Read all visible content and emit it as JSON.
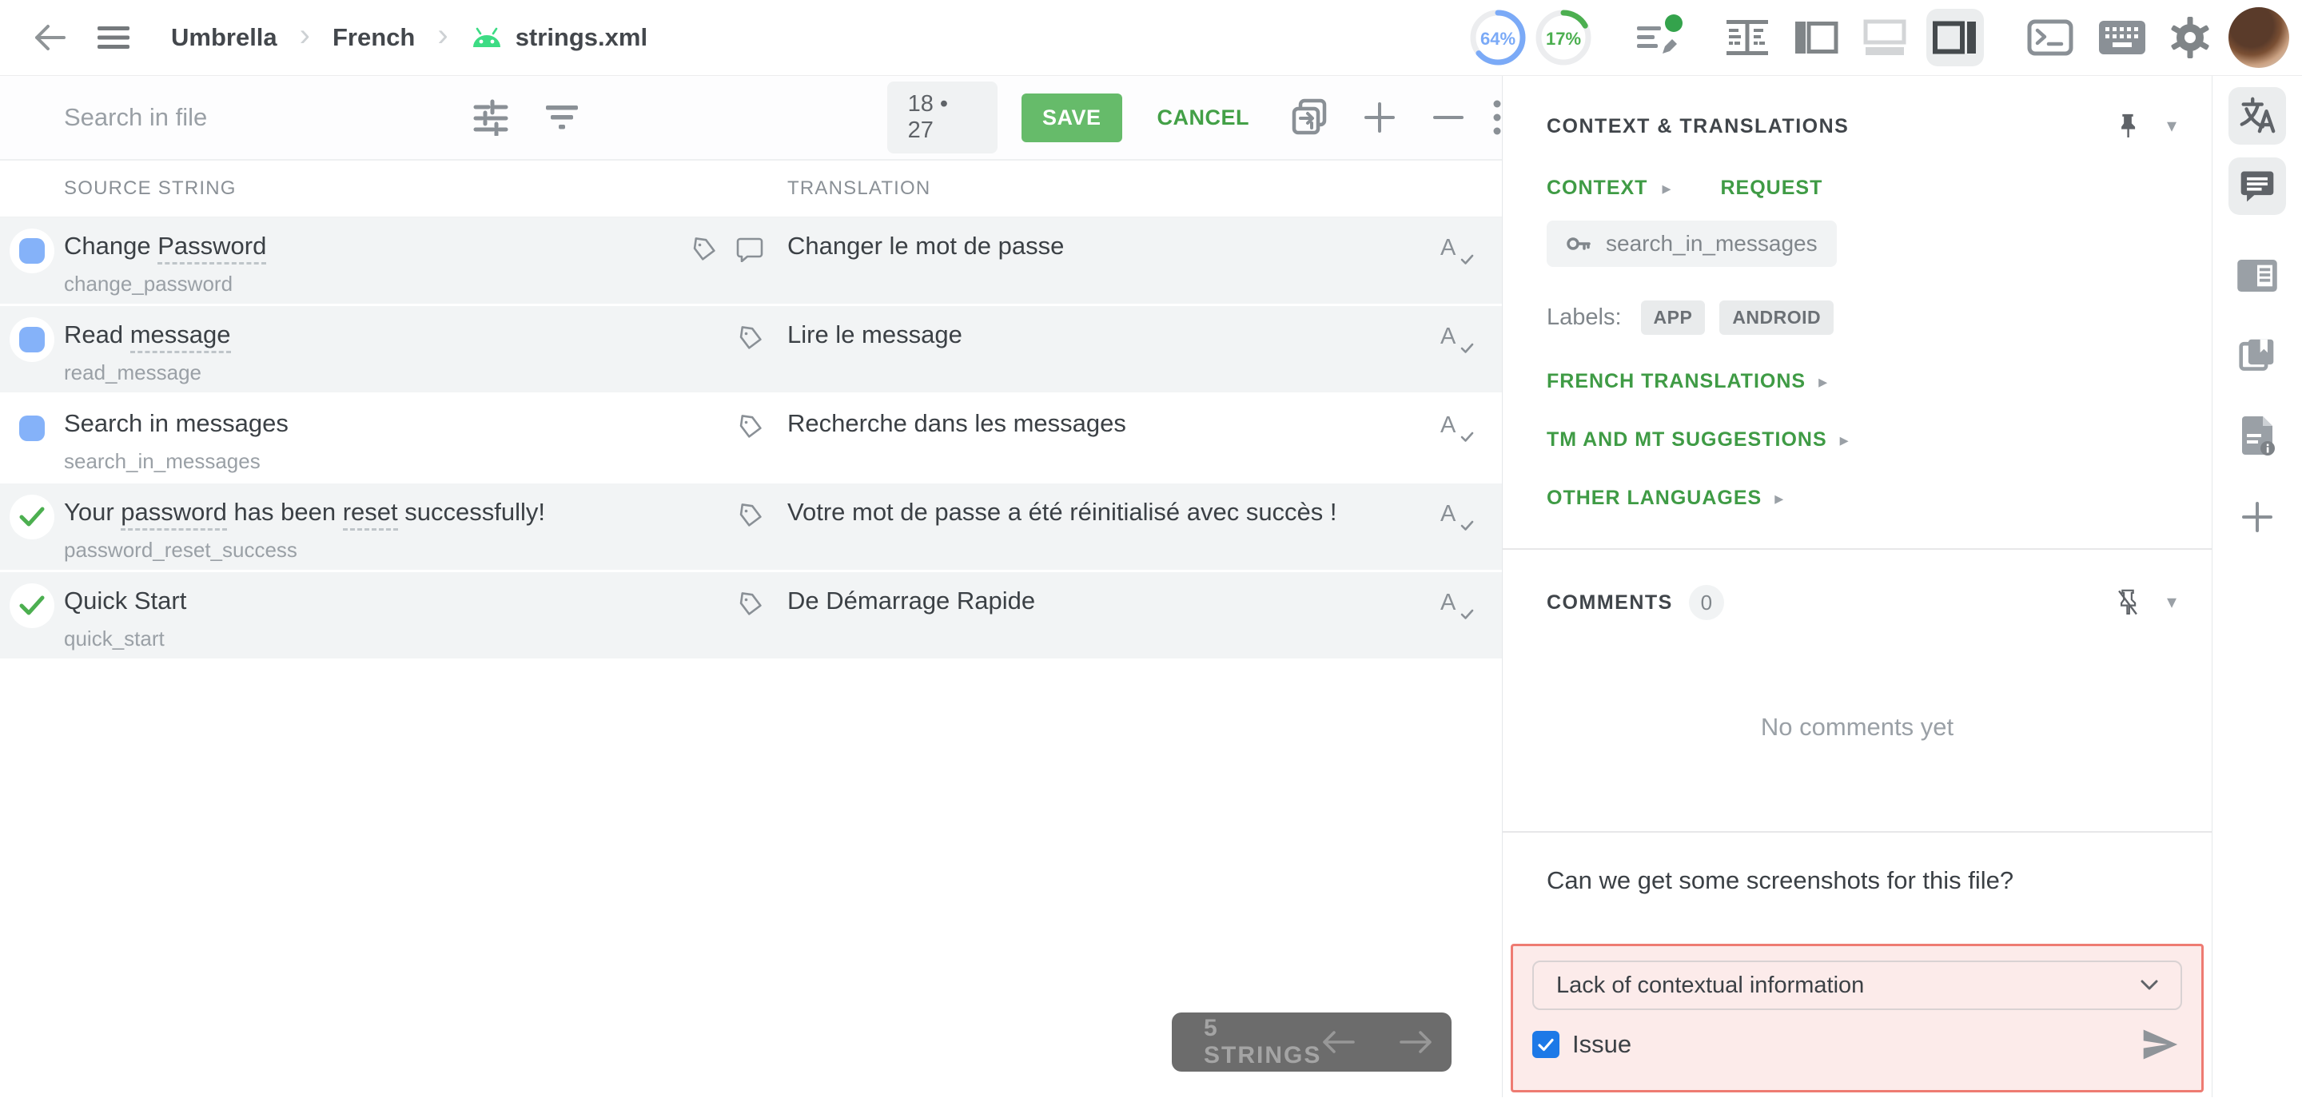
{
  "topbar": {
    "breadcrumb": {
      "project": "Umbrella",
      "language": "French",
      "file": "strings.xml"
    },
    "progress": [
      {
        "value": "64%",
        "percent": 64,
        "color": "#7baaf7"
      },
      {
        "value": "17%",
        "percent": 17,
        "color": "#4caf50"
      }
    ]
  },
  "toolbar": {
    "search_placeholder": "Search in file",
    "counter": "18 • 27",
    "save_label": "SAVE",
    "cancel_label": "CANCEL"
  },
  "table": {
    "source_header": "SOURCE STRING",
    "translation_header": "TRANSLATION",
    "rows": [
      {
        "status": "translated",
        "source": "Change Password",
        "underline": [
          "Password"
        ],
        "key": "change_password",
        "translation": "Changer le mot de passe",
        "icons": [
          "tag",
          "comment"
        ],
        "selected": false
      },
      {
        "status": "translated",
        "source": "Read message",
        "underline": [
          "message"
        ],
        "key": "read_message",
        "translation": "Lire le message",
        "icons": [
          "tag"
        ],
        "selected": false
      },
      {
        "status": "translated",
        "source": "Search in messages",
        "underline": [],
        "key": "search_in_messages",
        "translation": "Recherche dans les messages",
        "icons": [
          "tag"
        ],
        "selected": true
      },
      {
        "status": "approved",
        "source": "Your password has been reset successfully!",
        "underline": [
          "password",
          "reset"
        ],
        "key": "password_reset_success",
        "translation": "Votre mot de passe a été réinitialisé avec succès !",
        "icons": [
          "tag"
        ],
        "selected": false
      },
      {
        "status": "approved",
        "source": "Quick Start",
        "underline": [],
        "key": "quick_start",
        "translation": "De Démarrage Rapide",
        "icons": [
          "tag"
        ],
        "selected": false
      }
    ]
  },
  "pager": {
    "label": "5 STRINGS"
  },
  "context_panel": {
    "title": "CONTEXT & TRANSLATIONS",
    "tab_context": "CONTEXT",
    "tab_request": "REQUEST",
    "string_key": "search_in_messages",
    "labels_caption": "Labels:",
    "labels": [
      "APP",
      "ANDROID"
    ],
    "sections": [
      "FRENCH TRANSLATIONS",
      "TM AND MT SUGGESTIONS",
      "OTHER LANGUAGES"
    ]
  },
  "comments_panel": {
    "title": "COMMENTS",
    "count": "0",
    "empty_text": "No comments yet",
    "draft_text": "Can we get some screenshots for this file?",
    "issue_type_selected": "Lack of contextual information",
    "issue_checkbox_label": "Issue",
    "issue_checked": true
  },
  "colors": {
    "accent_green": "#43a047",
    "save_button": "#66bb6a",
    "status_translated": "#85b2f9",
    "status_approved": "#4caf50",
    "issue_border": "#ee7b72",
    "issue_background": "#fcebea",
    "checkbox_blue": "#1d79e7",
    "android_green": "#3ddc84"
  }
}
